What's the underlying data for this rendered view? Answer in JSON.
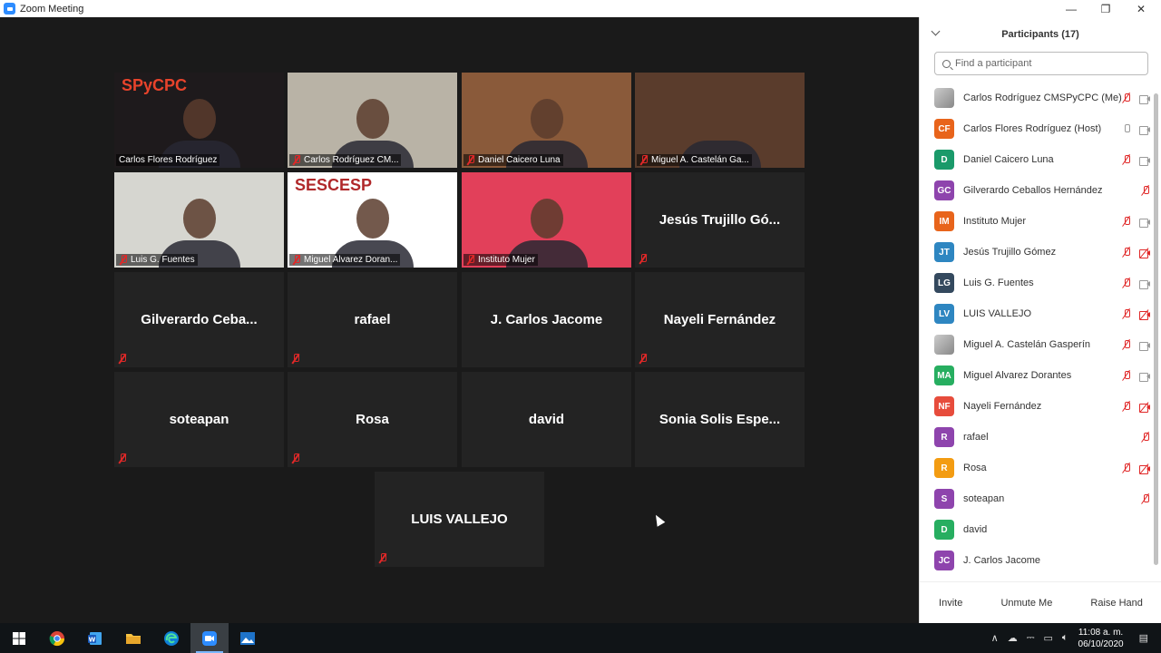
{
  "window": {
    "title": "Zoom Meeting"
  },
  "video_tiles": [
    {
      "label": "Carlos Flores Rodríguez",
      "muted": false,
      "video": true,
      "bg": "#1e1a1c",
      "logo_text": "SPyCPC"
    },
    {
      "label": "Carlos Rodríguez CM...",
      "muted": true,
      "video": true,
      "bg": "#b9b3a6"
    },
    {
      "label": "Daniel Caicero Luna",
      "muted": true,
      "video": true,
      "bg": "#8a5a3a"
    },
    {
      "label": "Miguel A. Castelán Ga...",
      "muted": true,
      "video": true,
      "bg": "#5a3c2c"
    },
    {
      "label": "Luis G. Fuentes",
      "muted": true,
      "video": true,
      "bg": "#d6d6d0"
    },
    {
      "label": "Miguel Alvarez Doran...",
      "muted": true,
      "video": true,
      "bg": "#ffffff",
      "logo_text": "SESCESP"
    },
    {
      "label": "Instituto Mujer",
      "muted": true,
      "video": true,
      "bg": "#e2405a"
    },
    {
      "name": "Jesús Trujillo Gó...",
      "muted": true,
      "video": false
    },
    {
      "name": "Gilverardo Ceba...",
      "muted": true,
      "video": false
    },
    {
      "name": "rafael",
      "muted": true,
      "video": false
    },
    {
      "name": "J. Carlos Jacome",
      "muted": false,
      "video": false
    },
    {
      "name": "Nayeli Fernández",
      "muted": true,
      "video": false
    },
    {
      "name": "soteapan",
      "muted": true,
      "video": false
    },
    {
      "name": "Rosa",
      "muted": true,
      "video": false
    },
    {
      "name": "david",
      "muted": false,
      "video": false
    },
    {
      "name": "Sonia Solis Espe...",
      "muted": false,
      "video": false
    },
    {
      "name": "LUIS VALLEJO",
      "muted": true,
      "video": false
    }
  ],
  "panel": {
    "title": "Participants (17)",
    "search_placeholder": "Find a participant",
    "participants": [
      {
        "name": "Carlos Rodríguez CMSPyCPC (Me)",
        "initials": "",
        "color": "img",
        "mic": "muted",
        "cam": "on"
      },
      {
        "name": "Carlos Flores Rodríguez (Host)",
        "initials": "CF",
        "color": "#e8641b",
        "mic": "on",
        "cam": "on"
      },
      {
        "name": "Daniel Caicero Luna",
        "initials": "D",
        "color": "#1a9a6a",
        "mic": "muted",
        "cam": "on"
      },
      {
        "name": "Gilverardo Ceballos Hernández",
        "initials": "GC",
        "color": "#8e44ad",
        "mic": "muted",
        "cam": "none"
      },
      {
        "name": "Instituto Mujer",
        "initials": "IM",
        "color": "#e8641b",
        "mic": "muted",
        "cam": "on"
      },
      {
        "name": "Jesús Trujillo Gómez",
        "initials": "JT",
        "color": "#2e86c1",
        "mic": "muted",
        "cam": "off"
      },
      {
        "name": "Luis G. Fuentes",
        "initials": "LG",
        "color": "#34495e",
        "mic": "muted",
        "cam": "on"
      },
      {
        "name": "LUIS VALLEJO",
        "initials": "LV",
        "color": "#2e86c1",
        "mic": "muted",
        "cam": "off"
      },
      {
        "name": "Miguel A. Castelán Gasperín",
        "initials": "",
        "color": "img",
        "mic": "muted",
        "cam": "on"
      },
      {
        "name": "Miguel Alvarez Dorantes",
        "initials": "MA",
        "color": "#27ae60",
        "mic": "muted",
        "cam": "on"
      },
      {
        "name": "Nayeli Fernández",
        "initials": "NF",
        "color": "#e74c3c",
        "mic": "muted",
        "cam": "off"
      },
      {
        "name": "rafael",
        "initials": "R",
        "color": "#8e44ad",
        "mic": "muted",
        "cam": "none"
      },
      {
        "name": "Rosa",
        "initials": "R",
        "color": "#f39c12",
        "mic": "muted",
        "cam": "off"
      },
      {
        "name": "soteapan",
        "initials": "S",
        "color": "#8e44ad",
        "mic": "muted",
        "cam": "none"
      },
      {
        "name": "david",
        "initials": "D",
        "color": "#27ae60",
        "mic": "none",
        "cam": "none"
      },
      {
        "name": "J. Carlos Jacome",
        "initials": "JC",
        "color": "#8e44ad",
        "mic": "none",
        "cam": "none"
      }
    ],
    "footer": {
      "invite": "Invite",
      "unmute": "Unmute Me",
      "raise_hand": "Raise Hand"
    }
  },
  "taskbar": {
    "time": "11:08 a. m.",
    "date": "06/10/2020"
  }
}
